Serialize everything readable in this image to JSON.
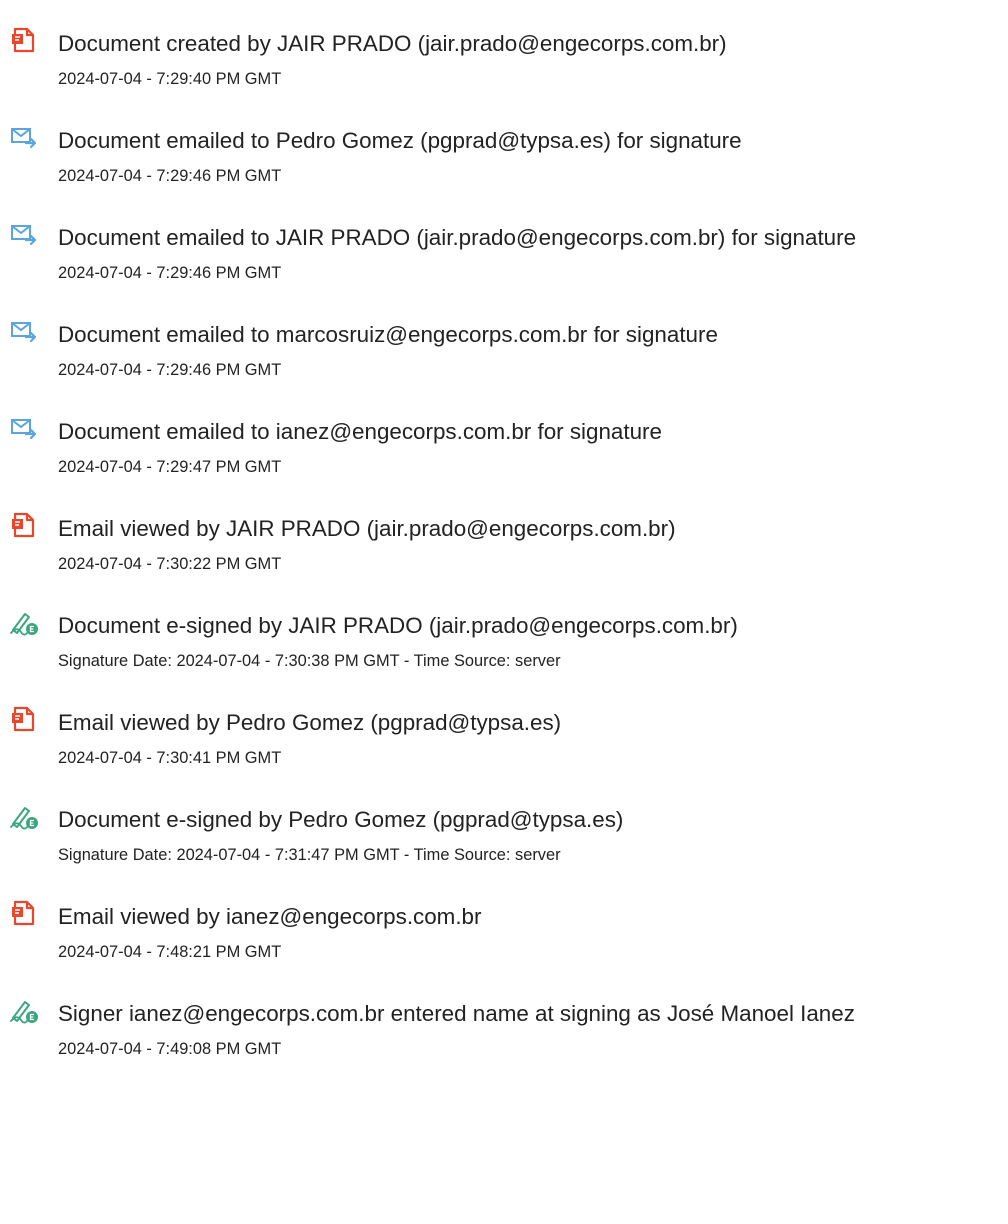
{
  "audit_events": [
    {
      "icon": "document-created-icon",
      "title": "Document created by JAIR PRADO (jair.prado@engecorps.com.br)",
      "date": "2024-07-04 - 7:29:40 PM GMT"
    },
    {
      "icon": "email-sent-icon",
      "title": "Document emailed to Pedro Gomez (pgprad@typsa.es) for signature",
      "date": "2024-07-04 - 7:29:46 PM GMT"
    },
    {
      "icon": "email-sent-icon",
      "title": "Document emailed to JAIR PRADO (jair.prado@engecorps.com.br) for signature",
      "date": "2024-07-04 - 7:29:46 PM GMT"
    },
    {
      "icon": "email-sent-icon",
      "title": "Document emailed to marcosruiz@engecorps.com.br for signature",
      "date": "2024-07-04 - 7:29:46 PM GMT"
    },
    {
      "icon": "email-sent-icon",
      "title": "Document emailed to ianez@engecorps.com.br for signature",
      "date": "2024-07-04 - 7:29:47 PM GMT"
    },
    {
      "icon": "email-viewed-icon",
      "title": "Email viewed by JAIR PRADO (jair.prado@engecorps.com.br)",
      "date": "2024-07-04 - 7:30:22 PM GMT"
    },
    {
      "icon": "e-signed-icon",
      "title": "Document e-signed by JAIR PRADO (jair.prado@engecorps.com.br)",
      "date": "Signature Date: 2024-07-04 - 7:30:38 PM GMT - Time Source: server"
    },
    {
      "icon": "email-viewed-icon",
      "title": "Email viewed by Pedro Gomez (pgprad@typsa.es)",
      "date": "2024-07-04 - 7:30:41 PM GMT"
    },
    {
      "icon": "e-signed-icon",
      "title": "Document e-signed by Pedro Gomez (pgprad@typsa.es)",
      "date": "Signature Date: 2024-07-04 - 7:31:47 PM GMT - Time Source: server"
    },
    {
      "icon": "email-viewed-icon",
      "title": "Email viewed by ianez@engecorps.com.br",
      "date": "2024-07-04 - 7:48:21 PM GMT"
    },
    {
      "icon": "e-signed-icon",
      "title": "Signer ianez@engecorps.com.br entered name at signing as José Manoel Ianez",
      "date": "2024-07-04 - 7:49:08 PM GMT"
    }
  ],
  "colors": {
    "document_red": "#e8472c",
    "email_blue": "#5aa6dc",
    "sign_green": "#3aa77f",
    "text": "#222222"
  }
}
